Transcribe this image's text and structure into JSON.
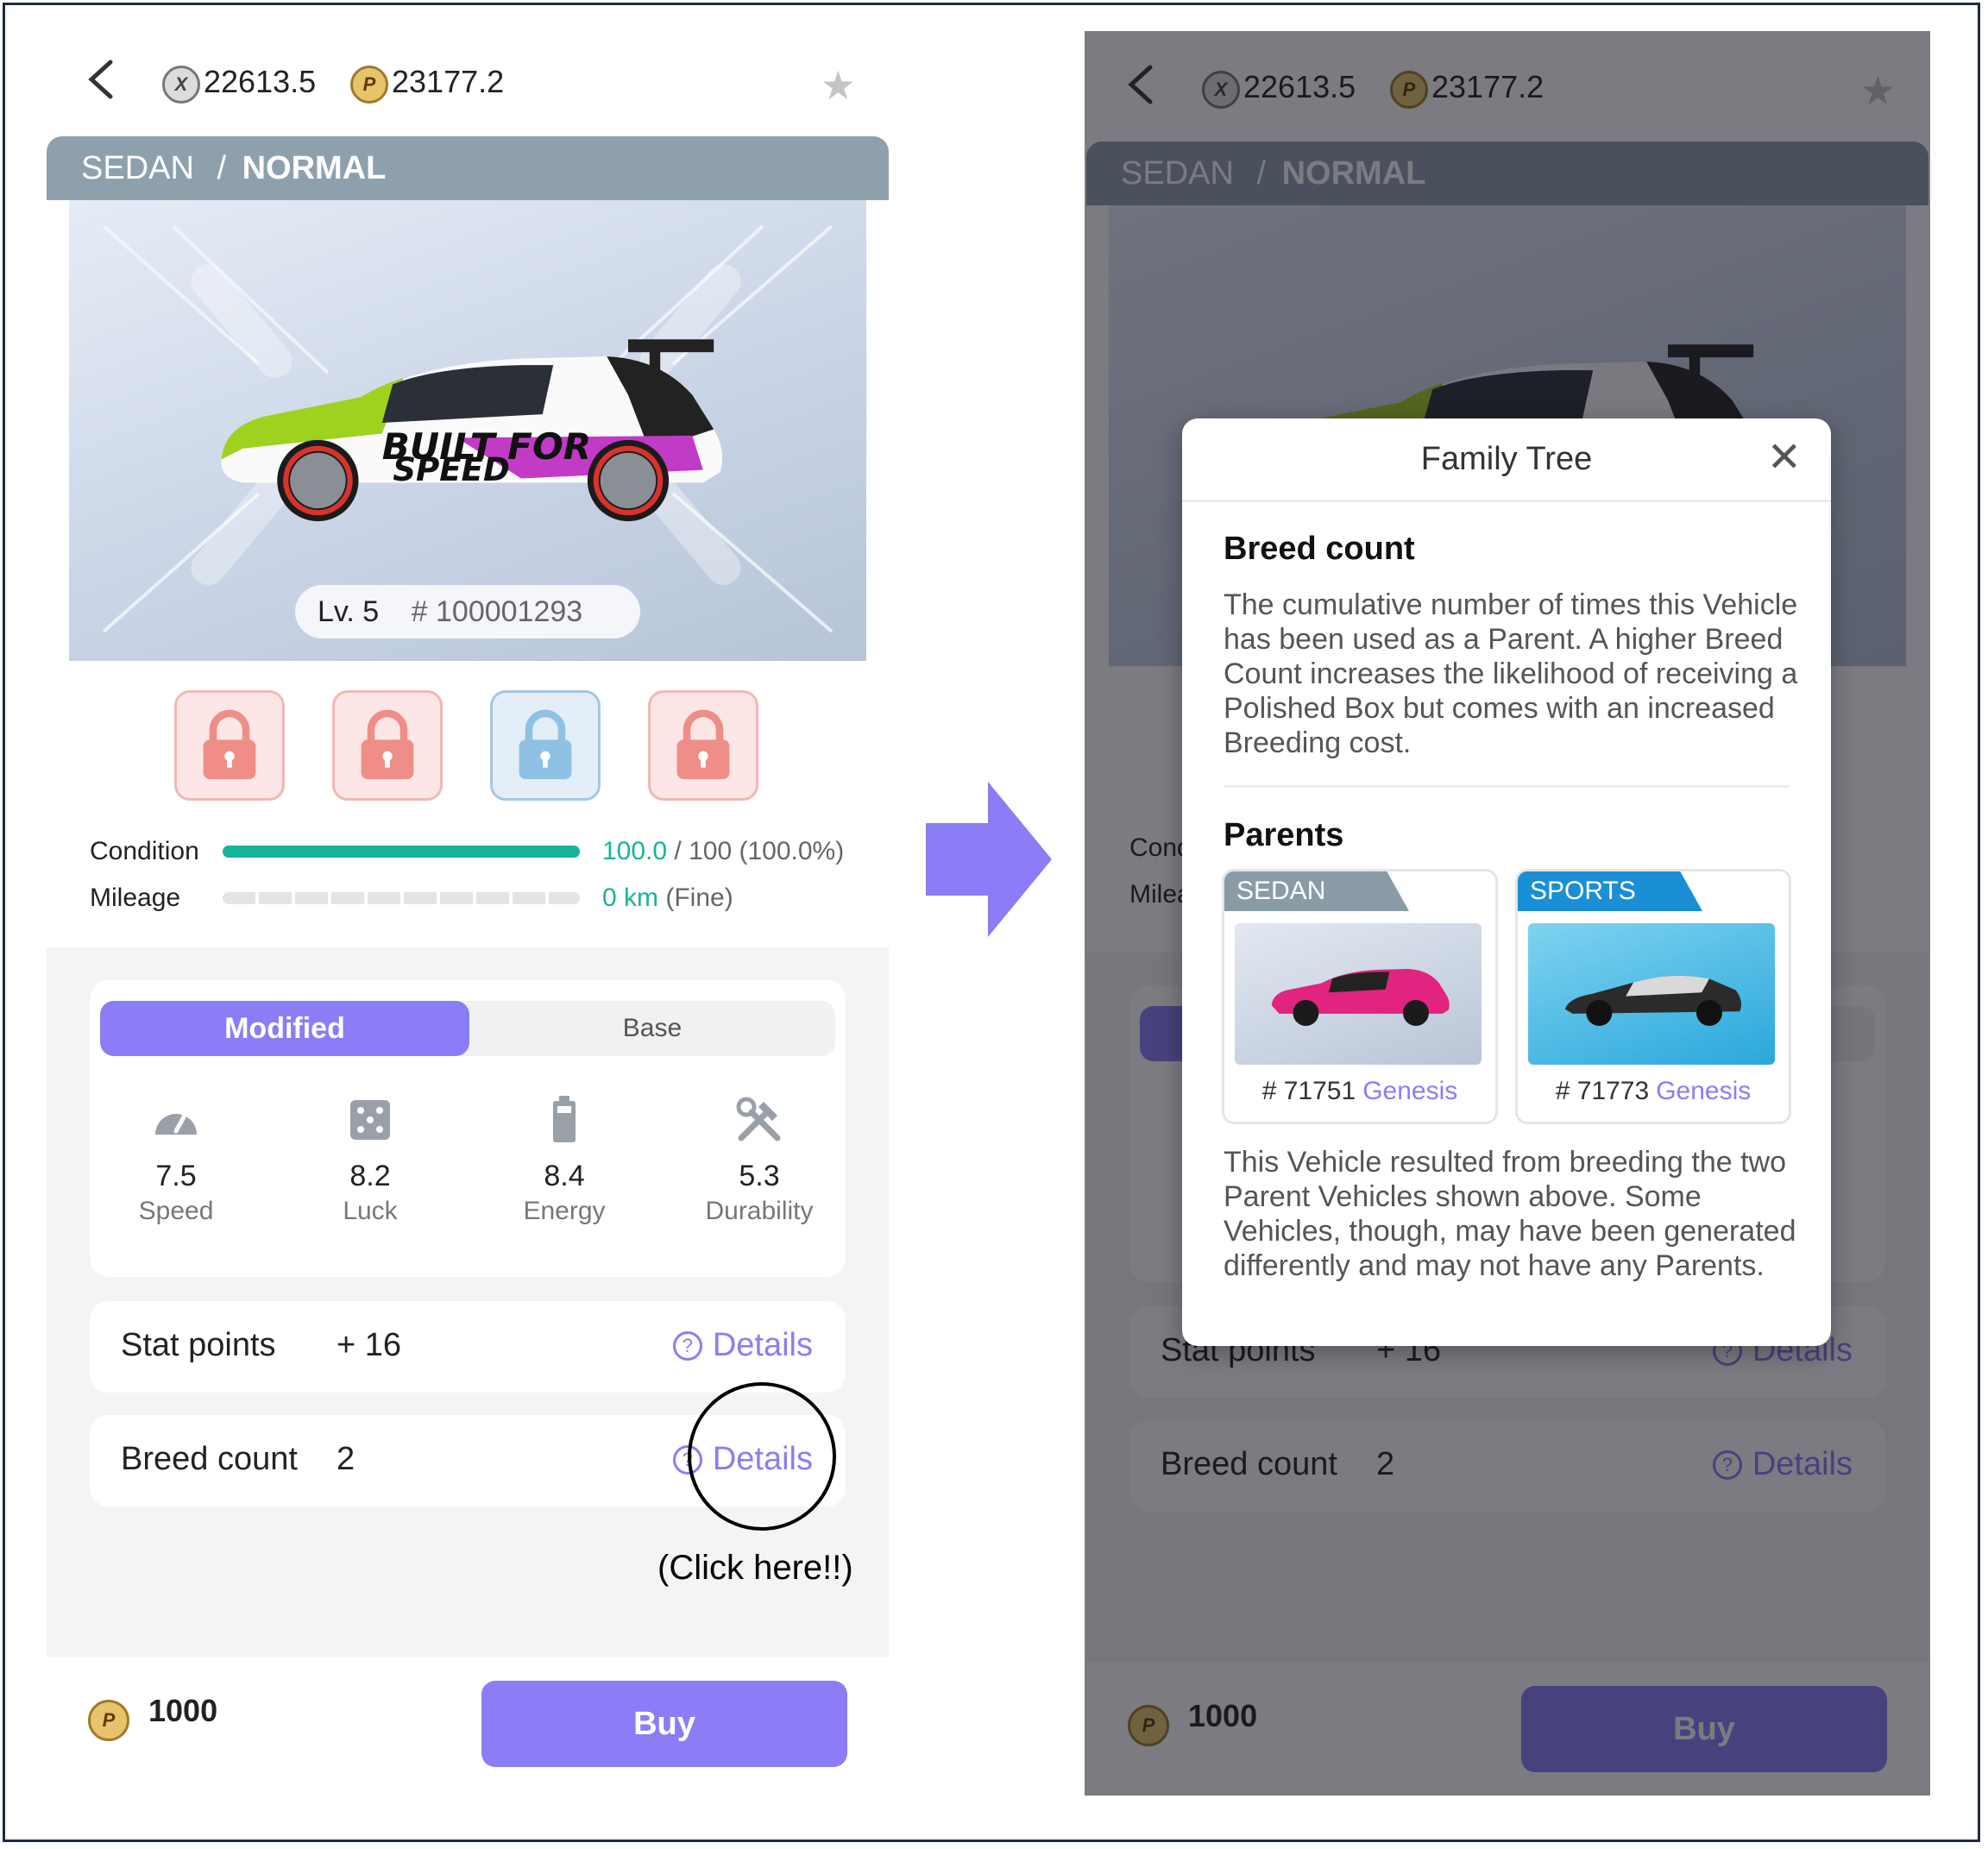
{
  "header": {
    "xp_balance": "22613.5",
    "p_balance": "23177.2"
  },
  "vehicle": {
    "category": "SEDAN",
    "separator": "/",
    "rarity": "NORMAL",
    "level": "Lv. 5",
    "id": "# 100001293"
  },
  "meters": {
    "condition_label": "Condition",
    "condition_value": "100.0",
    "condition_rest": "/ 100 (100.0%)",
    "condition_fraction": 1.0,
    "mileage_label": "Mileage",
    "mileage_value": "0 km",
    "mileage_rest": "(Fine)"
  },
  "tabs": {
    "modified": "Modified",
    "base": "Base"
  },
  "stats": [
    {
      "value": "7.5",
      "name": "Speed",
      "icon": "speedometer-icon"
    },
    {
      "value": "8.2",
      "name": "Luck",
      "icon": "dice-icon"
    },
    {
      "value": "8.4",
      "name": "Energy",
      "icon": "battery-icon"
    },
    {
      "value": "5.3",
      "name": "Durability",
      "icon": "tools-icon"
    }
  ],
  "stat_points": {
    "label": "Stat points",
    "value": "+ 16",
    "details": "Details"
  },
  "breed": {
    "label": "Breed count",
    "value": "2",
    "details": "Details"
  },
  "annotation": {
    "click_here": "(Click here!!)"
  },
  "purchase": {
    "price": "1000",
    "buy_label": "Buy"
  },
  "modal": {
    "title": "Family Tree",
    "breed_heading": "Breed count",
    "breed_text": "The cumulative number of times this Vehicle has been used as a Parent. A higher Breed Count increases the likelihood of receiving a Polished Box but comes with an increased Breeding cost.",
    "parents_heading": "Parents",
    "parents": [
      {
        "type": "SEDAN",
        "id": "# 71751",
        "tag": "Genesis"
      },
      {
        "type": "SPORTS",
        "id": "# 71773",
        "tag": "Genesis"
      }
    ],
    "footer_text": "This Vehicle resulted from breeding the two Parent Vehicles shown above. Some Vehicles, though, may have been generated differently and may not have any Parents."
  },
  "colors": {
    "accent": "#8a7df5",
    "condition": "#17b49a",
    "lock_red": "#ee8e87",
    "lock_blue": "#8ec1e4",
    "sports_tag": "#1a8fd6"
  }
}
